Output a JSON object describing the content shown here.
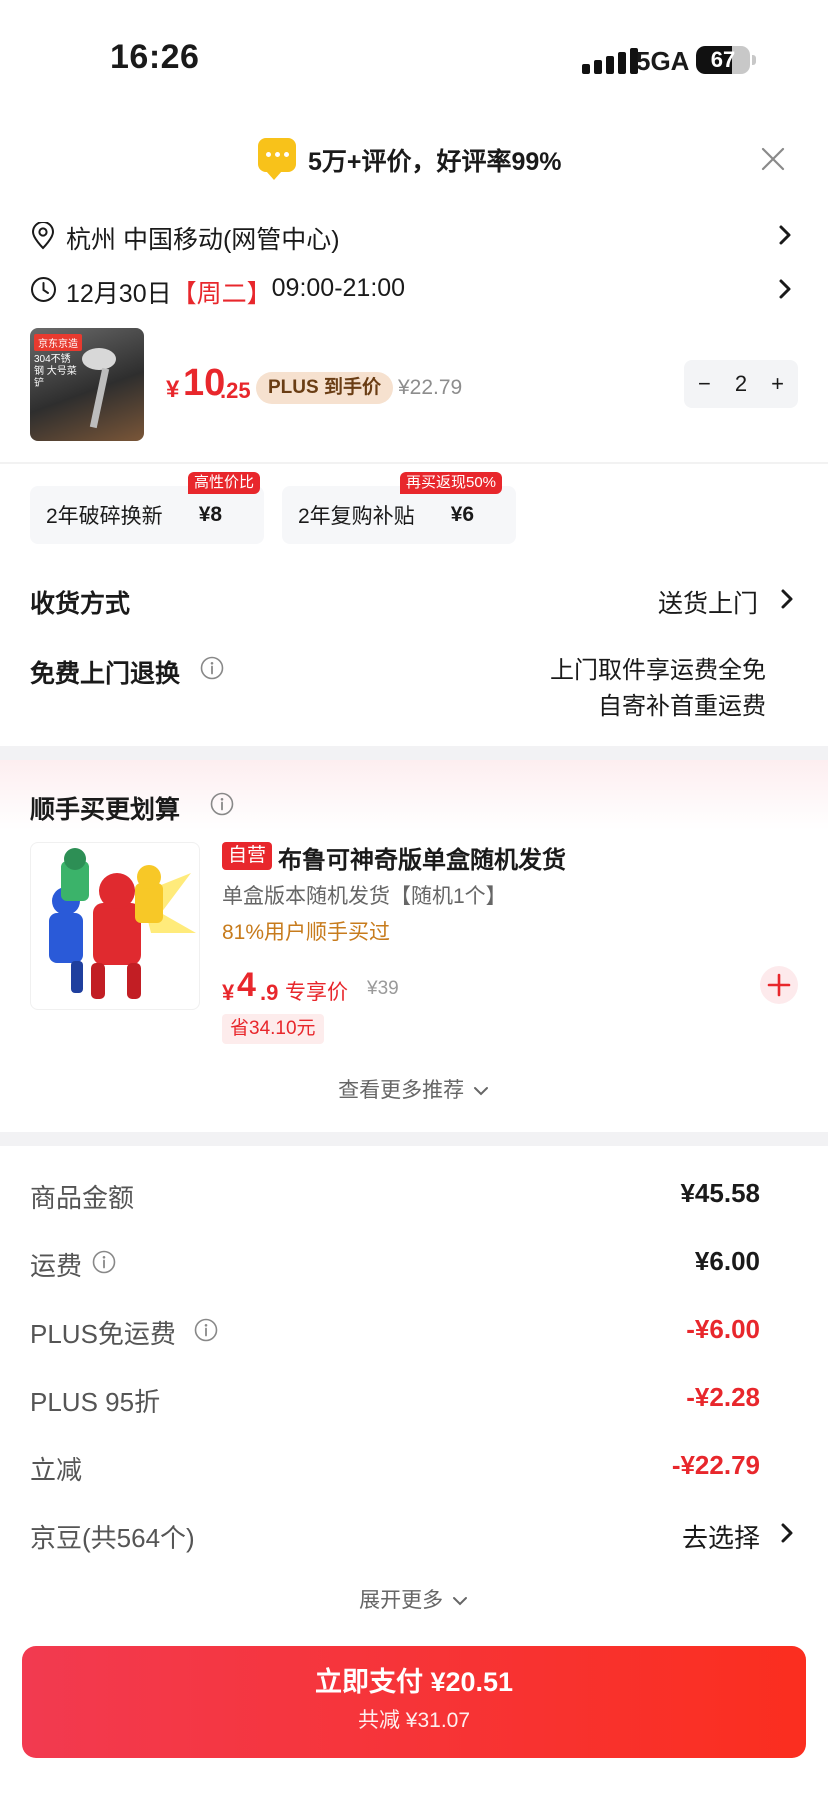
{
  "status_bar": {
    "time": "16:26",
    "network": "5GA",
    "battery": "67",
    "battery_level": 0.67
  },
  "banner": {
    "text": "5万+评价，好评率99%"
  },
  "address": {
    "text": "杭州 中国移动(网管中心)"
  },
  "delivery_time": {
    "date": "12月30日",
    "weekday": "【周二】",
    "window": "09:00-21:00"
  },
  "product": {
    "thumb_tag": "京东京造",
    "thumb_text": "304不锈钢 大号菜铲",
    "price_symbol": "¥",
    "price_int": "10",
    "price_dec": ".25",
    "plus_label": "PLUS 到手价",
    "original_price": "¥22.79",
    "quantity": "2",
    "minus": "−",
    "plus": "+"
  },
  "services": [
    {
      "label": "2年破碎换新",
      "amount": "¥8",
      "badge": "高性价比"
    },
    {
      "label": "2年复购补贴",
      "amount": "¥6",
      "badge": "再买返现50%"
    }
  ],
  "shipping": {
    "label": "收货方式",
    "value": "送货上门"
  },
  "returns": {
    "label": "免费上门退换",
    "line1": "上门取件享运费全免",
    "line2": "自寄补首重运费"
  },
  "recommend": {
    "heading": "顺手买更划算",
    "badge": "自营",
    "title": "布鲁可神奇版单盒随机发货",
    "subtitle": "单盒版本随机发货【随机1个】",
    "users": "81%用户顺手买过",
    "price_symbol": "¥",
    "price_int": "4",
    "price_dec": ".9",
    "exclusive": "专享价",
    "original": "¥39",
    "saving": "省34.10元",
    "more": "查看更多推荐"
  },
  "summary": [
    {
      "label": "商品金额",
      "value": "¥45.58",
      "negative": false
    },
    {
      "label": "运费",
      "value": "¥6.00",
      "negative": false
    },
    {
      "label": "PLUS免运费",
      "value": "-¥6.00",
      "negative": true
    },
    {
      "label": "PLUS 95折",
      "value": "-¥2.28",
      "negative": true
    },
    {
      "label": "立减",
      "value": "-¥22.79",
      "negative": true
    },
    {
      "label": "京豆(共564个)",
      "value": "去选择",
      "negative": false
    }
  ],
  "expand_more": "展开更多",
  "pay": {
    "main": "立即支付 ¥20.51",
    "sub": "共减 ¥31.07"
  },
  "colors": {
    "accent": "#e8272c",
    "plus_badge_bg": "#f6e1cf",
    "users_text": "#c77b1c"
  }
}
